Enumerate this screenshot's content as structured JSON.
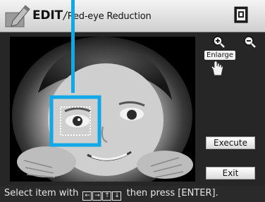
{
  "header": {
    "title_main": "EDIT",
    "title_separator": "/",
    "title_sub": "Red-eye  Reduction",
    "edit_icon": "pencil-edit-icon",
    "print_icon": "print-icon"
  },
  "side_panel": {
    "zoom_in_icon": "zoom-in-icon",
    "zoom_out_icon": "zoom-out-icon",
    "enlarge_label": "Enlarge",
    "hand_icon": "hand-cursor-icon",
    "execute_label": "Execute",
    "exit_label": "Exit"
  },
  "status": {
    "text_before": "Select item with",
    "keys": [
      "←",
      "→",
      "↑",
      "↓"
    ],
    "text_after": " then press [ENTER]."
  },
  "colors": {
    "accent": "#12a7e6",
    "header_bg": "#dcdcdc",
    "screen_bg": "#262626"
  }
}
